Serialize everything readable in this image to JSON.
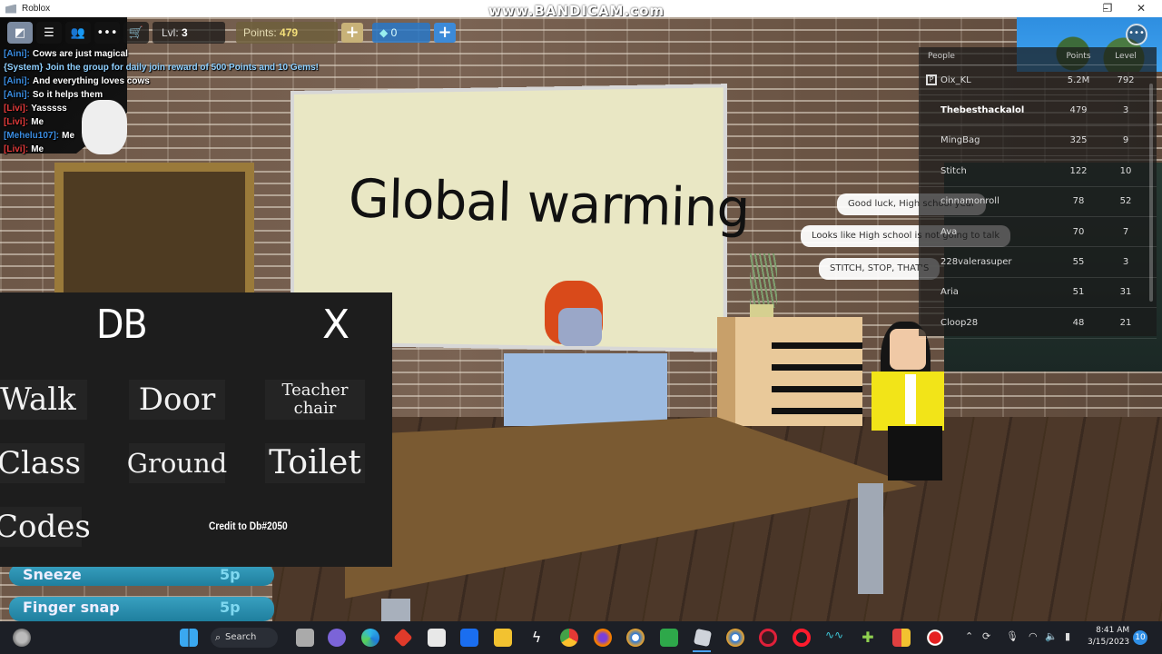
{
  "window": {
    "title": "Roblox",
    "controls": {
      "minimize": "–",
      "maximize": "❐",
      "close": "✕"
    }
  },
  "watermark": "www.BANDICAM.com",
  "topbar": {
    "buttons": [
      {
        "name": "roblox-menu",
        "icon": "roblox-logo-icon"
      },
      {
        "name": "chat",
        "icon": "chat-icon"
      },
      {
        "name": "friends",
        "icon": "people-icon"
      },
      {
        "name": "more",
        "icon": "ellipsis-icon"
      },
      {
        "name": "shop",
        "icon": "cart-icon"
      }
    ],
    "level_label": "Lvl:",
    "level_value": "3",
    "points_label": "Points:",
    "points_value": "479",
    "points_plus": "+",
    "gems_value": "0",
    "gems_plus": "+",
    "menu_icon": "•••"
  },
  "chat": {
    "messages": [
      {
        "name": "[Aini]:",
        "name_color": "#3a8ce0",
        "text": "Cows are just magical"
      },
      {
        "name": "{System}",
        "name_color": "#7ec8ff",
        "text": "Join the group for daily join reward of 500 Points and 10 Gems!",
        "system": true
      },
      {
        "name": "[Aini]:",
        "name_color": "#3a8ce0",
        "text": "And everything loves cows"
      },
      {
        "name": "[Aini]:",
        "name_color": "#3a8ce0",
        "text": "So it helps them"
      },
      {
        "name": "[Livi]:",
        "name_color": "#e03a3a",
        "text": "Yasssss"
      },
      {
        "name": "[Livi]:",
        "name_color": "#e03a3a",
        "text": "Me"
      },
      {
        "name": "[Mehelu107]:",
        "name_color": "#3a8ce0",
        "text": "Me"
      },
      {
        "name": "[Livi]:",
        "name_color": "#e03a3a",
        "text": "Me"
      }
    ]
  },
  "scene": {
    "whiteboard_text": "Global warming"
  },
  "bubbles": [
    {
      "text": "Good luck, High school year"
    },
    {
      "text": "Looks like High school is not going to talk"
    },
    {
      "text": "STITCH, STOP, THAT'S"
    }
  ],
  "leaderboard": {
    "headers": {
      "people": "People",
      "points": "Points",
      "level": "Level"
    },
    "rows": [
      {
        "name": "Oix_KL",
        "points": "5.2M",
        "level": "792",
        "premium": true
      },
      {
        "name": "Thebesthackalol",
        "points": "479",
        "level": "3",
        "me": true
      },
      {
        "name": "MingBag",
        "points": "325",
        "level": "9"
      },
      {
        "name": "Stitch",
        "points": "122",
        "level": "10"
      },
      {
        "name": "cinnamonroll",
        "points": "78",
        "level": "52"
      },
      {
        "name": "Ava",
        "points": "70",
        "level": "7"
      },
      {
        "name": "228valerasuper",
        "points": "55",
        "level": "3"
      },
      {
        "name": "Aria",
        "points": "51",
        "level": "31"
      },
      {
        "name": "Cloop28",
        "points": "48",
        "level": "21"
      }
    ]
  },
  "db_panel": {
    "title": "DB",
    "close": "X",
    "buttons": [
      "Walk",
      "Door",
      "Teacher chair",
      "Class",
      "Ground",
      "Toilet",
      "Codes"
    ],
    "credit": "Credit to Db#2050"
  },
  "emotes": [
    {
      "name": "Sneeze",
      "cost": "5p"
    },
    {
      "name": "Finger snap",
      "cost": "5p"
    }
  ],
  "taskbar": {
    "search_label": "Search",
    "apps": [
      "weather",
      "start",
      "search",
      "task-view",
      "teams",
      "edge",
      "app-red",
      "store",
      "dropbox",
      "file-explorer",
      "app-bolt",
      "chrome",
      "firefox",
      "browser-shield",
      "app-green",
      "roblox",
      "browser-shield-2",
      "opera-gx",
      "opera",
      "app-wave",
      "app-cross",
      "app-grid",
      "bandicam-record"
    ],
    "time": "8:41 AM",
    "date": "3/15/2023",
    "notifications": "10"
  },
  "colors": {
    "panel_bg": "#1d1d1d",
    "emote_bg": "#2a8fb0",
    "points_gold": "#f5e07a",
    "gems_blue": "#3c8ad8"
  }
}
